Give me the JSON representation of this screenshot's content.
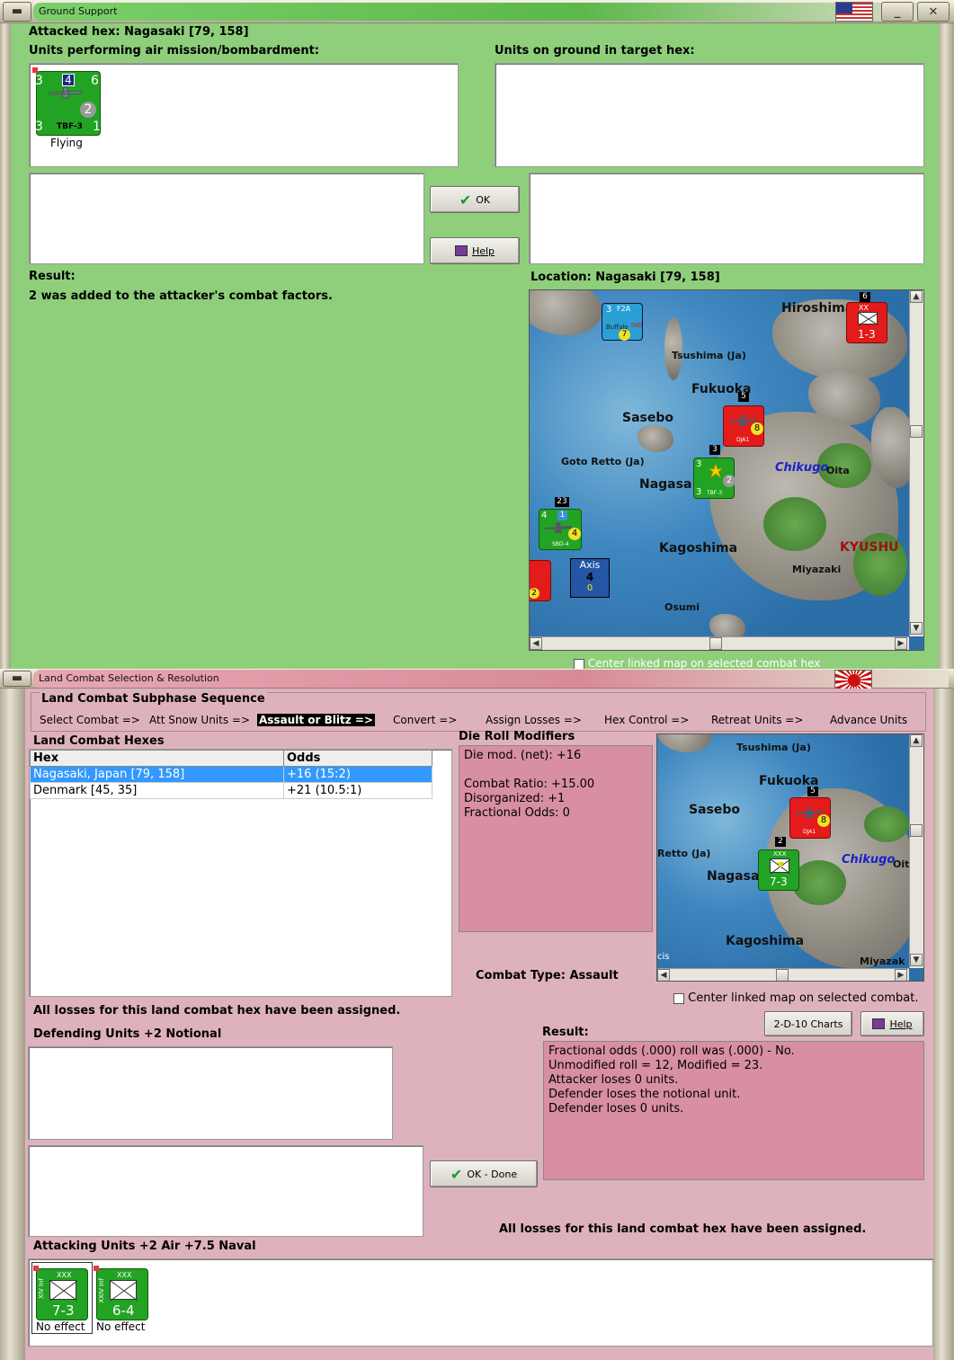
{
  "ground": {
    "title": "Ground Support",
    "attacked_hex": "Attacked hex: Nagasaki  [79, 158]",
    "units_air_label": "Units performing air mission/bombardment:",
    "units_ground_label": "Units on ground in target hex:",
    "air_unit": {
      "name": "TBF-3",
      "top_left": "3",
      "top_mid": "4",
      "top_right": "6",
      "mid": "2",
      "bot_left": "3",
      "bot_right": "1",
      "status": "Flying"
    },
    "ok_label": "OK",
    "help_label": "Help",
    "result_label": "Result:",
    "result_text": "2 was added to the attacker's combat factors.",
    "location_label": "Location:  Nagasaki  [79, 158]",
    "center_linked": "Center linked map on selected combat hex"
  },
  "map1": {
    "labels": {
      "hiroshima": "Hiroshima",
      "tsushima": "Tsushima (Ja)",
      "fukuoka": "Fukuoka",
      "sasebo": "Sasebo",
      "goto": "Goto Retto (Ja)",
      "nagasaki": "Nagasa",
      "kagoshima": "Kagoshima",
      "kyushu": "KYUSHU",
      "miyazaki": "Miyazaki",
      "osumi": "Osumi",
      "chikugo": "Chikugo",
      "oita": "Oita"
    },
    "axis_box": {
      "label": "Axis",
      "value1": "4",
      "value2": "0"
    },
    "counters": {
      "buffalo": {
        "name": "F2A",
        "sub": "Buffalo",
        "a": "3",
        "b": "7",
        "tag": "IND"
      },
      "xx_red": {
        "tag": "XX",
        "value": "1-3",
        "stack": "6"
      },
      "fukuoka_air": {
        "stack": "5",
        "value": "8",
        "name": "DJA1"
      },
      "tbf": {
        "stack": "3",
        "a": "3",
        "b": "2",
        "c": "3",
        "name": "TBF-3"
      },
      "sbd": {
        "stack": "23",
        "a": "4",
        "b": "1",
        "c": "4",
        "name": "SBD-4"
      },
      "left_red": {
        "value": "2"
      }
    }
  },
  "land": {
    "title": "Land Combat Selection & Resolution",
    "subphase_label": "Land Combat Subphase Sequence",
    "steps": [
      "Select Combat =>",
      "Att Snow Units =>",
      "Assault or Blitz =>",
      "Convert =>",
      "Assign Losses =>",
      "Hex Control =>",
      "Retreat Units =>",
      "Advance Units"
    ],
    "active_step": "Assault or Blitz =>",
    "hexes_label": "Land Combat Hexes",
    "col_hex": "Hex",
    "col_odds": "Odds",
    "rows": [
      {
        "hex": "Nagasaki, Japan [79, 158]",
        "odds": "+16 (15:2)"
      },
      {
        "hex": "Denmark [45, 35]",
        "odds": "+21 (10.5:1)"
      }
    ],
    "drm_label": "Die Roll Modifiers",
    "drm_lines": [
      "Die mod. (net): +16",
      "",
      "Combat Ratio: +15.00",
      "Disorganized: +1",
      "Fractional Odds: 0"
    ],
    "combat_type": "Combat Type:  Assault",
    "center_linked": "Center linked map on selected combat.",
    "losses_assigned": "All losses for this land combat hex have been assigned.",
    "defending_label": "Defending Units +2 Notional",
    "charts_label": "2-D-10 Charts",
    "help_label": "Help",
    "result_label": "Result:",
    "result_lines": [
      "Fractional odds (.000) roll was (.000)  - No.",
      "Unmodified roll = 12, Modified = 23.",
      "Attacker loses 0 units.",
      "Defender loses the notional unit.",
      "Defender loses 0 units."
    ],
    "ok_done_label": "OK - Done",
    "losses_assigned2": "All losses for this land combat hex have been assigned.",
    "attacking_label": "Attacking Units +2 Air +7.5 Naval",
    "attackers": [
      {
        "corps": "XIV Inf",
        "size": "XXX",
        "value": "7-3",
        "status": "No effect"
      },
      {
        "corps": "XXIV Inf",
        "size": "XXX",
        "value": "6-4",
        "status": "No effect"
      }
    ]
  },
  "map2": {
    "labels": {
      "tsushima": "Tsushima (Ja)",
      "fukuoka": "Fukuoka",
      "sasebo": "Sasebo",
      "retto": "Retto (Ja)",
      "nagasaki": "Nagasa",
      "kagoshima": "Kagoshima",
      "chikugo": "Chikugo",
      "oit": "Oit",
      "miyazaki": "Miyazak",
      "cis": "cis"
    },
    "counters": {
      "air": {
        "stack": "5",
        "value": "8",
        "name": "DJA1"
      },
      "inf": {
        "stack": "2",
        "size": "XXX",
        "value": "7-3"
      }
    }
  },
  "colors": {
    "green_bg": "#8fce7b",
    "pink_bg": "#deb2bc",
    "us_green": "#23a323",
    "japan_red": "#e31b1b",
    "selected_row": "#3399ff"
  }
}
